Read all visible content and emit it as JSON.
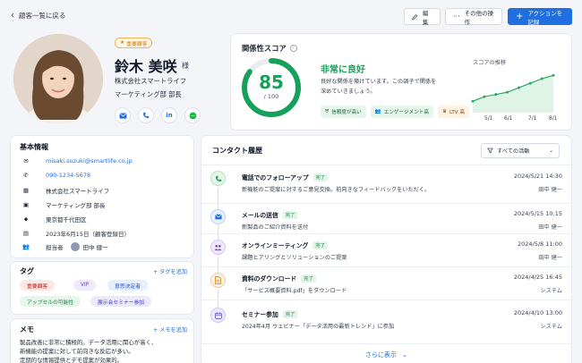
{
  "topbar": {
    "back_label": "顧客一覧に戻る",
    "edit_label": "編集",
    "more_label": "その他の操作",
    "record_label": "アクションを記録"
  },
  "profile": {
    "badge": "重要顧客",
    "name": "鈴木 美咲",
    "honorific": "様",
    "company": "株式会社スマートライフ",
    "department": "マーケティング部 部長",
    "socials": [
      "mail-icon",
      "phone-icon",
      "linkedin-icon",
      "chat-icon"
    ]
  },
  "score": {
    "title": "関係性スコア",
    "value": "85",
    "max_label": "/ 100",
    "value_fraction": 0.85,
    "grade": "非常に良好",
    "description": "良好な関係を築けています。この調子で関係を深めていきましょう。",
    "chips": [
      "信頼度が高い",
      "エンゲージメント高",
      "LTV 高"
    ],
    "trend_title": "スコアの推移",
    "trend_labels": [
      "5/1",
      "6/1",
      "7/1",
      "8/1"
    ],
    "trend_values": [
      62,
      66,
      68,
      70,
      74,
      78,
      82,
      85
    ],
    "colors": {
      "good": "#16a05a",
      "primary": "#1f6fe0"
    }
  },
  "basic": {
    "title": "基本情報",
    "email": "misaki.suzuki@smartlife.co.jp",
    "phone": "090-1234-5678",
    "company": "株式会社スマートライフ",
    "department": "マーケティング部 部長",
    "address": "東京都千代田区",
    "registered": "2023年6月15日（顧客登録日）",
    "owner_label": "担当者",
    "owner_name": "田中 健一"
  },
  "tags": {
    "title": "タグ",
    "add_label": "+ タグを追加",
    "items": [
      "重要顧客",
      "VIP",
      "意思決定者",
      "アップセルの可能性",
      "展示会セミナー参加"
    ]
  },
  "memo": {
    "title": "メモ",
    "add_label": "+ メモを追加",
    "lines": [
      "製品改善に非常に積極的。データ活用に関心が高く、",
      "新機能の提案に対して前向きな反応が多い。",
      "定期的な情報提供とデモ提案が効果的。"
    ]
  },
  "history": {
    "title": "コンタクト履歴",
    "filter_label": "すべての活動",
    "status_label": "完了",
    "more_label": "さらに表示",
    "items": [
      {
        "title": "電話でのフォローアップ",
        "desc": "新機能のご提案に対するご意見交換。前向きなフィードバックをいただく。",
        "date": "2024/5/21 14:30",
        "who": "田中 健一",
        "icon": "phone-icon"
      },
      {
        "title": "メールの送信",
        "desc": "新製品のご紹介資料を送付",
        "date": "2024/5/15 10:15",
        "who": "田中 健一",
        "icon": "mail-icon"
      },
      {
        "title": "オンラインミーティング",
        "desc": "課題ヒアリングとソリューションのご提案",
        "date": "2024/5/8 11:00",
        "who": "田中 健一",
        "icon": "meeting-icon"
      },
      {
        "title": "資料のダウンロード",
        "desc": "「サービス概要資料.pdf」をダウンロード",
        "date": "2024/4/25 16:45",
        "who": "システム",
        "icon": "document-icon"
      },
      {
        "title": "セミナー参加",
        "desc": "2024年4月 ウェビナー「データ活用の最新トレンド」に参加",
        "date": "2024/4/10 13:00",
        "who": "システム",
        "icon": "calendar-icon"
      }
    ]
  }
}
